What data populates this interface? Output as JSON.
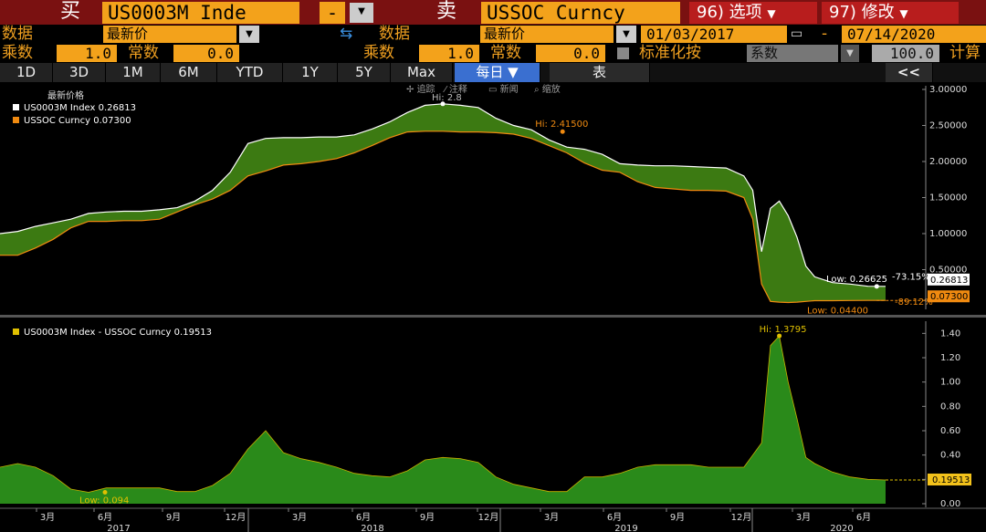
{
  "header": {
    "buy_label": "买",
    "buy_ticker": "US0003M Inde",
    "minus_label": "-",
    "sell_label": "卖",
    "sell_ticker": "USSOC Curncy",
    "options_button": "96) 选项",
    "modify_button": "97) 修改"
  },
  "row2": {
    "data_label_left": "数据",
    "data_value_left": "最新价",
    "data_label_right": "数据",
    "data_value_right": "最新价",
    "start_date": "01/03/2017",
    "dash": "-",
    "end_date": "07/14/2020"
  },
  "row3": {
    "mult_label_left": "乘数",
    "mult_value_left": "1.0",
    "const_label_left": "常数",
    "const_value_left": "0.0",
    "mult_label_right": "乘数",
    "mult_value_right": "1.0",
    "const_label_right": "常数",
    "const_value_right": "0.0",
    "normalize_label": "标准化按",
    "normalize_value": "系数",
    "normalize_number": "100.0",
    "calc_label": "计算"
  },
  "tabs": {
    "items": [
      "1D",
      "3D",
      "1M",
      "6M",
      "YTD",
      "1Y",
      "5Y",
      "Max"
    ],
    "frequency": "每日 ▼",
    "table_button": "表",
    "collapse_button": "<<"
  },
  "toolbar_hint": {
    "track": "追踪",
    "annotate": "注释",
    "news": "新闻",
    "zoom": "缩放"
  },
  "chart_data": [
    {
      "type": "area",
      "title": "最新价格",
      "legend": [
        {
          "name": "US0003M Index",
          "value": "0.26813",
          "color": "#ffffff"
        },
        {
          "name": "USSOC Curncy",
          "value": "0.07300",
          "color": "#f08a10"
        }
      ],
      "ylim": [
        0.0,
        3.0
      ],
      "yticks": [
        "3.00000",
        "2.50000",
        "2.00000",
        "1.50000",
        "1.00000",
        "0.50000"
      ],
      "series": [
        {
          "name": "US0003M Index",
          "color": "#ffffff",
          "x": [
            0,
            0.02,
            0.04,
            0.06,
            0.08,
            0.1,
            0.12,
            0.14,
            0.16,
            0.18,
            0.2,
            0.22,
            0.24,
            0.26,
            0.28,
            0.3,
            0.32,
            0.34,
            0.36,
            0.38,
            0.4,
            0.42,
            0.44,
            0.46,
            0.48,
            0.5,
            0.52,
            0.54,
            0.56,
            0.58,
            0.6,
            0.62,
            0.64,
            0.66,
            0.68,
            0.7,
            0.72,
            0.74,
            0.76,
            0.78,
            0.8,
            0.82,
            0.84,
            0.85,
            0.86,
            0.87,
            0.88,
            0.89,
            0.9,
            0.91,
            0.92,
            0.94,
            0.96,
            0.98,
            1.0
          ],
          "values": [
            1.0,
            1.03,
            1.1,
            1.15,
            1.2,
            1.28,
            1.3,
            1.31,
            1.31,
            1.33,
            1.36,
            1.45,
            1.6,
            1.85,
            2.25,
            2.32,
            2.33,
            2.33,
            2.34,
            2.34,
            2.37,
            2.45,
            2.55,
            2.68,
            2.78,
            2.8,
            2.78,
            2.75,
            2.6,
            2.5,
            2.44,
            2.3,
            2.2,
            2.17,
            2.1,
            1.97,
            1.95,
            1.94,
            1.94,
            1.93,
            1.92,
            1.91,
            1.8,
            1.6,
            0.75,
            1.35,
            1.45,
            1.25,
            0.95,
            0.55,
            0.4,
            0.32,
            0.3,
            0.27,
            0.26813
          ]
        },
        {
          "name": "USSOC Curncy",
          "color": "#f08a10",
          "x": [
            0,
            0.02,
            0.04,
            0.06,
            0.08,
            0.1,
            0.12,
            0.14,
            0.16,
            0.18,
            0.2,
            0.22,
            0.24,
            0.26,
            0.28,
            0.3,
            0.32,
            0.34,
            0.36,
            0.38,
            0.4,
            0.42,
            0.44,
            0.46,
            0.48,
            0.5,
            0.52,
            0.54,
            0.56,
            0.58,
            0.6,
            0.62,
            0.64,
            0.66,
            0.68,
            0.7,
            0.72,
            0.74,
            0.76,
            0.78,
            0.8,
            0.82,
            0.84,
            0.85,
            0.86,
            0.87,
            0.88,
            0.89,
            0.9,
            0.91,
            0.92,
            0.94,
            0.96,
            0.98,
            1.0
          ],
          "values": [
            0.7,
            0.7,
            0.8,
            0.92,
            1.08,
            1.17,
            1.17,
            1.18,
            1.18,
            1.2,
            1.3,
            1.4,
            1.48,
            1.6,
            1.8,
            1.87,
            1.95,
            1.97,
            2.0,
            2.04,
            2.12,
            2.22,
            2.33,
            2.41,
            2.42,
            2.42,
            2.41,
            2.41,
            2.4,
            2.38,
            2.32,
            2.22,
            2.12,
            1.98,
            1.88,
            1.85,
            1.72,
            1.64,
            1.62,
            1.6,
            1.6,
            1.59,
            1.5,
            1.2,
            0.3,
            0.06,
            0.05,
            0.044,
            0.05,
            0.06,
            0.07,
            0.07,
            0.072,
            0.073,
            0.073
          ]
        }
      ],
      "annotations": {
        "hi_white": "Hi: 2.8",
        "hi_orange": "Hi: 2.41500",
        "low_white": "Low: 0.26625",
        "low_orange": "Low: 0.04400",
        "pct_white": "-73.15%",
        "pct_orange": "-89.12%",
        "last_white": "0.26813",
        "last_orange": "0.07300"
      }
    },
    {
      "type": "area",
      "legend": [
        {
          "name": "US0003M Index - USSOC Curncy",
          "value": "0.19513",
          "color": "#e0c000"
        }
      ],
      "ylim": [
        0.0,
        1.5
      ],
      "yticks": [
        "1.40",
        "1.20",
        "1.00",
        "0.80",
        "0.60",
        "0.40",
        "0.20",
        "0.00"
      ],
      "series": [
        {
          "name": "US0003M Index - USSOC Curncy",
          "color": "#2a8a1a",
          "x": [
            0,
            0.02,
            0.04,
            0.06,
            0.08,
            0.1,
            0.12,
            0.14,
            0.16,
            0.18,
            0.2,
            0.22,
            0.24,
            0.26,
            0.28,
            0.3,
            0.32,
            0.34,
            0.36,
            0.38,
            0.4,
            0.42,
            0.44,
            0.46,
            0.48,
            0.5,
            0.52,
            0.54,
            0.56,
            0.58,
            0.6,
            0.62,
            0.64,
            0.66,
            0.68,
            0.7,
            0.72,
            0.74,
            0.76,
            0.78,
            0.8,
            0.82,
            0.84,
            0.85,
            0.86,
            0.87,
            0.88,
            0.89,
            0.9,
            0.91,
            0.92,
            0.94,
            0.96,
            0.98,
            1.0
          ],
          "values": [
            0.3,
            0.33,
            0.3,
            0.23,
            0.12,
            0.094,
            0.13,
            0.13,
            0.13,
            0.13,
            0.1,
            0.1,
            0.15,
            0.25,
            0.45,
            0.6,
            0.42,
            0.37,
            0.34,
            0.3,
            0.25,
            0.23,
            0.22,
            0.27,
            0.36,
            0.38,
            0.37,
            0.34,
            0.22,
            0.16,
            0.13,
            0.1,
            0.1,
            0.22,
            0.22,
            0.25,
            0.3,
            0.32,
            0.32,
            0.32,
            0.3,
            0.3,
            0.3,
            0.4,
            0.5,
            1.3,
            1.3795,
            1.0,
            0.7,
            0.38,
            0.33,
            0.26,
            0.22,
            0.2,
            0.19513
          ]
        }
      ],
      "annotations": {
        "hi": "Hi: 1.3795",
        "low": "Low: 0.094",
        "last": "0.19513"
      }
    }
  ],
  "x_axis": {
    "months": [
      "3月",
      "6月",
      "9月",
      "12月",
      "3月",
      "6月",
      "9月",
      "12月",
      "3月",
      "6月",
      "9月",
      "12月",
      "3月",
      "6月"
    ],
    "years": [
      "2017",
      "2018",
      "2019",
      "2020"
    ]
  }
}
